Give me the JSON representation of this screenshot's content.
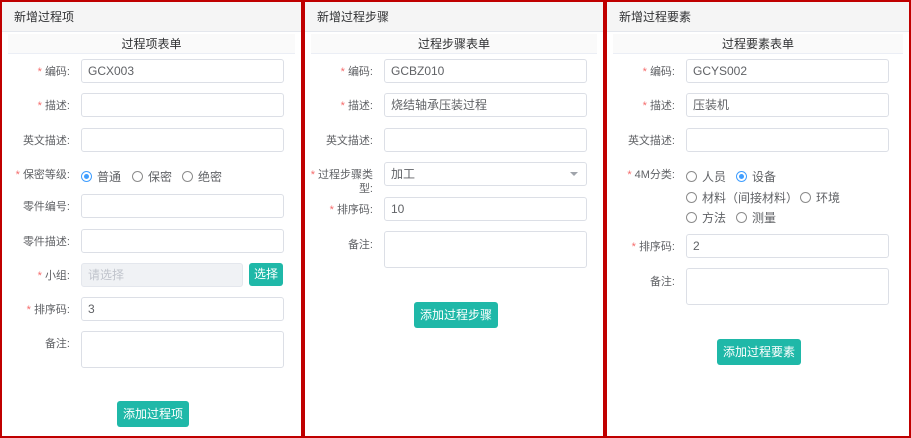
{
  "panel1": {
    "header": "新增过程项",
    "form_title": "过程项表单",
    "code_label": "编码:",
    "code_value": "GCX003",
    "desc_label": "描述:",
    "desc_value": "",
    "en_desc_label": "英文描述:",
    "en_desc_value": "",
    "secret_label": "保密等级:",
    "secret_options": [
      "普通",
      "保密",
      "绝密"
    ],
    "secret_selected": "普通",
    "part_no_label": "零件编号:",
    "part_no_value": "",
    "part_desc_label": "零件描述:",
    "part_desc_value": "",
    "group_label": "小组:",
    "group_placeholder": "请选择",
    "select_button": "选择",
    "order_label": "排序码:",
    "order_value": "3",
    "remark_label": "备注:",
    "submit_button": "添加过程项"
  },
  "panel2": {
    "header": "新增过程步骤",
    "form_title": "过程步骤表单",
    "code_label": "编码:",
    "code_value": "GCBZ010",
    "desc_label": "描述:",
    "desc_value": "烧结轴承压装过程",
    "en_desc_label": "英文描述:",
    "en_desc_value": "",
    "type_label_line1": "过程步骤类",
    "type_label_line2": "型:",
    "type_value": "加工",
    "order_label": "排序码:",
    "order_value": "10",
    "remark_label": "备注:",
    "submit_button": "添加过程步骤"
  },
  "panel3": {
    "header": "新增过程要素",
    "form_title": "过程要素表单",
    "code_label": "编码:",
    "code_value": "GCYS002",
    "desc_label": "描述:",
    "desc_value": "压装机",
    "en_desc_label": "英文描述:",
    "en_desc_value": "",
    "m4_label": "4M分类:",
    "m4_options": [
      "人员",
      "设备",
      "材料（间接材料）",
      "环境",
      "方法",
      "测量"
    ],
    "m4_selected": "设备",
    "order_label": "排序码:",
    "order_value": "2",
    "remark_label": "备注:",
    "submit_button": "添加过程要素"
  },
  "colors": {
    "accent": "#1fb8a8",
    "radio_selected": "#409eff",
    "required": "#f56c6c",
    "frame": "#c00000"
  }
}
